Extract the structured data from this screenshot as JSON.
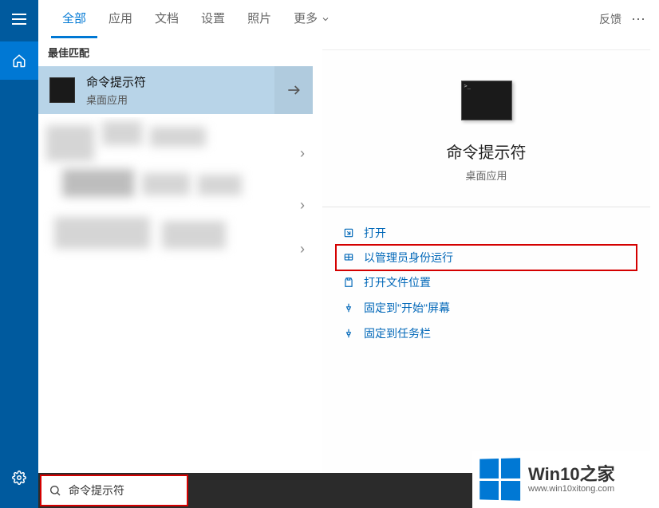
{
  "tabs": {
    "all": "全部",
    "apps": "应用",
    "docs": "文档",
    "settings": "设置",
    "photos": "照片",
    "more": "更多"
  },
  "header": {
    "feedback": "反馈"
  },
  "left": {
    "best_match": "最佳匹配",
    "result_title": "命令提示符",
    "result_sub": "桌面应用"
  },
  "detail": {
    "title": "命令提示符",
    "sub": "桌面应用"
  },
  "actions": {
    "open": "打开",
    "run_admin": "以管理员身份运行",
    "open_location": "打开文件位置",
    "pin_start": "固定到\"开始\"屏幕",
    "pin_taskbar": "固定到任务栏"
  },
  "search": {
    "value": "命令提示符"
  },
  "watermark": {
    "title": "Win10之家",
    "url": "www.win10xitong.com"
  }
}
